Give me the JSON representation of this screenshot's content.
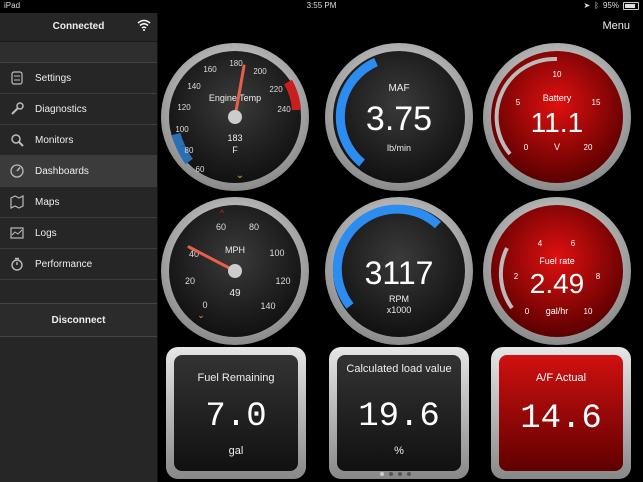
{
  "status_bar": {
    "device": "iPad",
    "time": "3:55 PM",
    "battery": "95%"
  },
  "sidebar": {
    "connection_status": "Connected",
    "items": [
      {
        "label": "Settings",
        "icon": "settings-icon"
      },
      {
        "label": "Diagnostics",
        "icon": "wrench-icon"
      },
      {
        "label": "Monitors",
        "icon": "magnifier-icon"
      },
      {
        "label": "Dashboards",
        "icon": "dashboard-icon",
        "active": true
      },
      {
        "label": "Maps",
        "icon": "map-icon"
      },
      {
        "label": "Logs",
        "icon": "logs-icon"
      },
      {
        "label": "Performance",
        "icon": "stopwatch-icon"
      }
    ],
    "disconnect_label": "Disconnect"
  },
  "header": {
    "menu_label": "Menu"
  },
  "gauges": {
    "engine_temp": {
      "label": "Engine Temp",
      "value": "183",
      "unit": "F",
      "ticks": [
        "60",
        "80",
        "100",
        "120",
        "140",
        "160",
        "180",
        "200",
        "220",
        "240"
      ],
      "needle_value": 183,
      "min": 60,
      "max": 240
    },
    "maf": {
      "label": "MAF",
      "value": "3.75",
      "unit": "lb/min",
      "fill_fraction": 0.45,
      "color": "#2d8cf0"
    },
    "battery": {
      "label": "Battery",
      "value": "11.1",
      "unit": "V",
      "ticks": [
        "0",
        "5",
        "10",
        "15",
        "20"
      ],
      "fill_fraction": 0.55,
      "color": "#cc0000"
    },
    "speed": {
      "label": "MPH",
      "value": "49",
      "ticks": [
        "0",
        "20",
        "40",
        "60",
        "80",
        "100",
        "120",
        "140"
      ],
      "needle_value": 49,
      "min": 0,
      "max": 140
    },
    "rpm": {
      "label": "RPM",
      "sublabel": "x1000",
      "value": "3117",
      "fill_fraction": 0.62,
      "color": "#2d8cf0"
    },
    "fuel_rate": {
      "label": "Fuel rate",
      "value": "2.49",
      "unit": "gal/hr",
      "ticks": [
        "0",
        "2",
        "4",
        "6",
        "8",
        "10"
      ],
      "fill_fraction": 0.25,
      "color": "#cc0000"
    },
    "fuel_remaining": {
      "label": "Fuel Remaining",
      "value": "7.0",
      "unit": "gal"
    },
    "calc_load": {
      "label": "Calculated load value",
      "value": "19.6",
      "unit": "%"
    },
    "af_actual": {
      "label": "A/F Actual",
      "value": "14.6"
    }
  },
  "colors": {
    "blue_accent": "#2d8cf0",
    "red_face": "#b30000",
    "needle": "#e8604a"
  }
}
